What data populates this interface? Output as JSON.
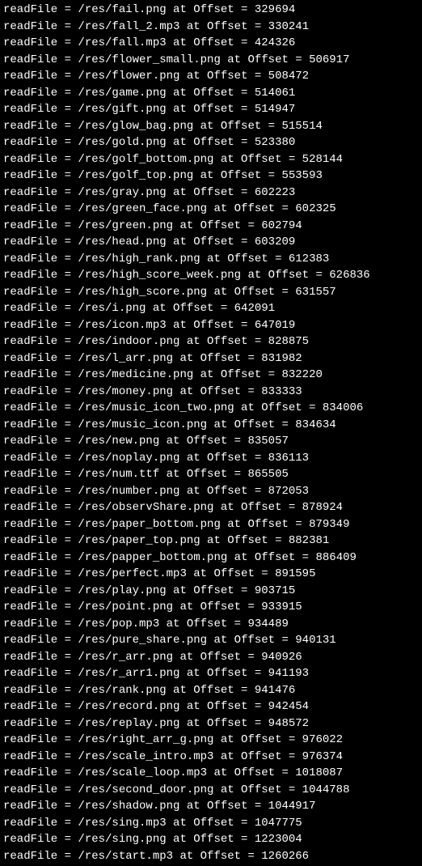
{
  "label": "readFile = ",
  "offset_label": " at Offset = ",
  "entries": [
    {
      "path": "/res/fail.png",
      "offset": "329694"
    },
    {
      "path": "/res/fall_2.mp3",
      "offset": "330241"
    },
    {
      "path": "/res/fall.mp3",
      "offset": "424326"
    },
    {
      "path": "/res/flower_small.png",
      "offset": "506917"
    },
    {
      "path": "/res/flower.png",
      "offset": "508472"
    },
    {
      "path": "/res/game.png",
      "offset": "514061"
    },
    {
      "path": "/res/gift.png",
      "offset": "514947"
    },
    {
      "path": "/res/glow_bag.png",
      "offset": "515514"
    },
    {
      "path": "/res/gold.png",
      "offset": "523380"
    },
    {
      "path": "/res/golf_bottom.png",
      "offset": "528144"
    },
    {
      "path": "/res/golf_top.png",
      "offset": "553593"
    },
    {
      "path": "/res/gray.png",
      "offset": "602223"
    },
    {
      "path": "/res/green_face.png",
      "offset": "602325"
    },
    {
      "path": "/res/green.png",
      "offset": "602794"
    },
    {
      "path": "/res/head.png",
      "offset": "603209"
    },
    {
      "path": "/res/high_rank.png",
      "offset": "612383"
    },
    {
      "path": "/res/high_score_week.png",
      "offset": "626836"
    },
    {
      "path": "/res/high_score.png",
      "offset": "631557"
    },
    {
      "path": "/res/i.png",
      "offset": "642091"
    },
    {
      "path": "/res/icon.mp3",
      "offset": "647019"
    },
    {
      "path": "/res/indoor.png",
      "offset": "828875"
    },
    {
      "path": "/res/l_arr.png",
      "offset": "831982"
    },
    {
      "path": "/res/medicine.png",
      "offset": "832220"
    },
    {
      "path": "/res/money.png",
      "offset": "833333"
    },
    {
      "path": "/res/music_icon_two.png",
      "offset": "834006"
    },
    {
      "path": "/res/music_icon.png",
      "offset": "834634"
    },
    {
      "path": "/res/new.png",
      "offset": "835057"
    },
    {
      "path": "/res/noplay.png",
      "offset": "836113"
    },
    {
      "path": "/res/num.ttf",
      "offset": "865505"
    },
    {
      "path": "/res/number.png",
      "offset": "872053"
    },
    {
      "path": "/res/observShare.png",
      "offset": "878924"
    },
    {
      "path": "/res/paper_bottom.png",
      "offset": "879349"
    },
    {
      "path": "/res/paper_top.png",
      "offset": "882381"
    },
    {
      "path": "/res/papper_bottom.png",
      "offset": "886409"
    },
    {
      "path": "/res/perfect.mp3",
      "offset": "891595"
    },
    {
      "path": "/res/play.png",
      "offset": "903715"
    },
    {
      "path": "/res/point.png",
      "offset": "933915"
    },
    {
      "path": "/res/pop.mp3",
      "offset": "934489"
    },
    {
      "path": "/res/pure_share.png",
      "offset": "940131"
    },
    {
      "path": "/res/r_arr.png",
      "offset": "940926"
    },
    {
      "path": "/res/r_arr1.png",
      "offset": "941193"
    },
    {
      "path": "/res/rank.png",
      "offset": "941476"
    },
    {
      "path": "/res/record.png",
      "offset": "942454"
    },
    {
      "path": "/res/replay.png",
      "offset": "948572"
    },
    {
      "path": "/res/right_arr_g.png",
      "offset": "976022"
    },
    {
      "path": "/res/scale_intro.mp3",
      "offset": "976374"
    },
    {
      "path": "/res/scale_loop.mp3",
      "offset": "1018087"
    },
    {
      "path": "/res/second_door.png",
      "offset": "1044788"
    },
    {
      "path": "/res/shadow.png",
      "offset": "1044917"
    },
    {
      "path": "/res/sing.mp3",
      "offset": "1047775"
    },
    {
      "path": "/res/sing.png",
      "offset": "1223004"
    },
    {
      "path": "/res/start.mp3",
      "offset": "1260266"
    }
  ]
}
